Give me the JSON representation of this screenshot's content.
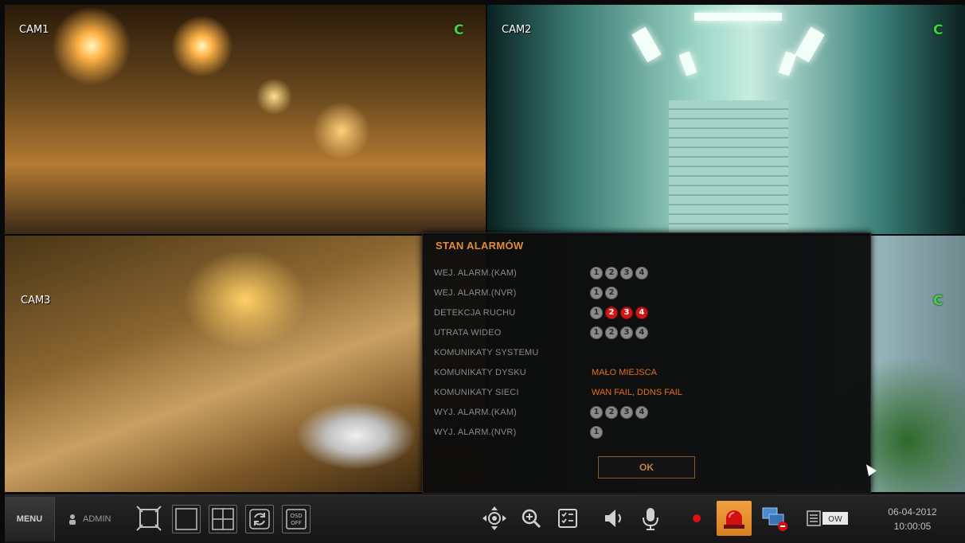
{
  "cameras": [
    {
      "label": "CAM1",
      "status": "C"
    },
    {
      "label": "CAM2",
      "status": "C"
    },
    {
      "label": "CAM3",
      "status": ""
    },
    {
      "label": "",
      "status": "C"
    }
  ],
  "alarm_dialog": {
    "title": "STAN ALARMÓW",
    "rows": [
      {
        "label": "WEJ. ALARM.(KAM)",
        "channels": [
          "1",
          "2",
          "3",
          "4"
        ],
        "active": []
      },
      {
        "label": "WEJ. ALARM.(NVR)",
        "channels": [
          "1",
          "2"
        ],
        "active": []
      },
      {
        "label": "DETEKCJA RUCHU",
        "channels": [
          "1",
          "2",
          "3",
          "4"
        ],
        "active": [
          "2",
          "3",
          "4"
        ]
      },
      {
        "label": "UTRATA WIDEO",
        "channels": [
          "1",
          "2",
          "3",
          "4"
        ],
        "active": []
      },
      {
        "label": "KOMUNIKATY SYSTEMU",
        "message": ""
      },
      {
        "label": "KOMUNIKATY DYSKU",
        "message": "MAŁO MIEJSCA"
      },
      {
        "label": "KOMUNIKATY SIECI",
        "message": "WAN FAIL, DDNS FAIL"
      },
      {
        "label": "WYJ. ALARM.(KAM)",
        "channels": [
          "1",
          "2",
          "3",
          "4"
        ],
        "active": []
      },
      {
        "label": "WYJ. ALARM.(NVR)",
        "channels": [
          "1"
        ],
        "active": []
      }
    ],
    "ok_label": "OK"
  },
  "toolbar": {
    "menu_label": "MENU",
    "user_label": "ADMIN",
    "osd_label_top": "OSD",
    "osd_label_bottom": "OFF",
    "ow_label": "OW",
    "date": "06-04-2012",
    "time": "10:00:05"
  },
  "colors": {
    "accent": "#e08a3c",
    "alarm_active": "#d01616",
    "status_ok": "#3fd13f"
  }
}
